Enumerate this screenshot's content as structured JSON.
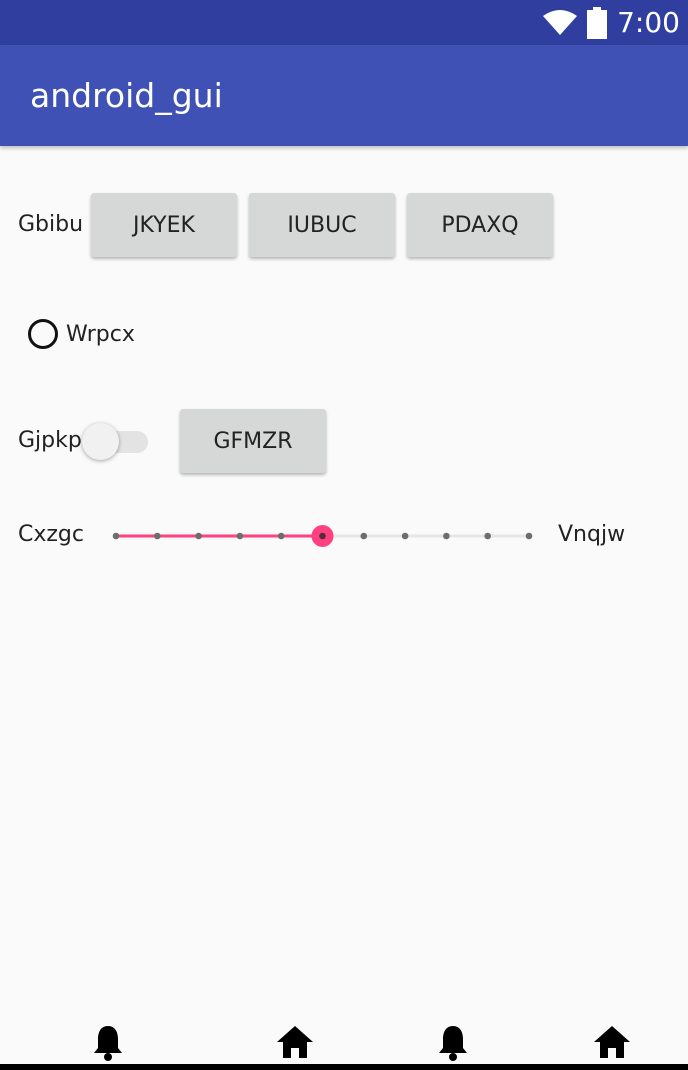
{
  "status_bar": {
    "time": "7:00",
    "icons": [
      "wifi-icon",
      "battery-icon"
    ],
    "background": "#303f9f"
  },
  "app_bar": {
    "title": "android_gui",
    "background": "#3f51b5"
  },
  "row1": {
    "label": "Gbibu",
    "buttons": [
      "JKYEK",
      "IUBUC",
      "PDAXQ"
    ]
  },
  "radio": {
    "label": "Wrpcx",
    "checked": false
  },
  "row3": {
    "switch_label": "Gjpkp",
    "switch_on": false,
    "button": "GFMZR"
  },
  "seekbar": {
    "start_label": "Cxzgc",
    "end_label": "Vnqjw",
    "max": 10,
    "value": 5,
    "accent": "#ff4081"
  },
  "nav_bar": {
    "icons": [
      "bell-icon",
      "home-icon",
      "bell-icon",
      "home-icon"
    ]
  }
}
